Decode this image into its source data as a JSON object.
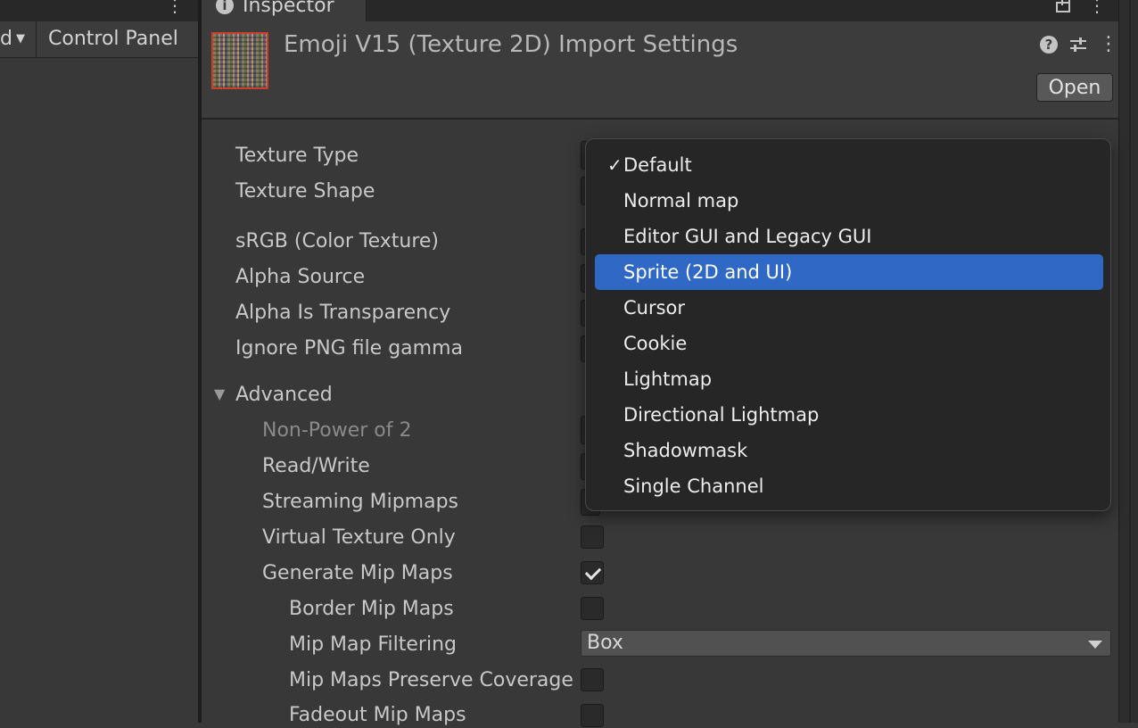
{
  "left_panel": {
    "dropdown_text": "d",
    "tab_label": "Control Panel"
  },
  "inspector": {
    "tab_title": "Inspector"
  },
  "header": {
    "title": "Emoji V15 (Texture 2D) Import Settings",
    "open_label": "Open"
  },
  "fields": {
    "texture_type": "Texture Type",
    "texture_shape": "Texture Shape",
    "srgb": "sRGB (Color Texture)",
    "alpha_source": "Alpha Source",
    "alpha_is_transparency": "Alpha Is Transparency",
    "ignore_png_gamma": "Ignore PNG file gamma",
    "advanced": "Advanced",
    "non_power_of_2": "Non-Power of 2",
    "read_write": "Read/Write",
    "streaming_mipmaps": "Streaming Mipmaps",
    "virtual_texture_only": "Virtual Texture Only",
    "generate_mip_maps": "Generate Mip Maps",
    "border_mip_maps": "Border Mip Maps",
    "mip_map_filtering": "Mip Map Filtering",
    "mip_map_filtering_value": "Box",
    "mip_maps_preserve_coverage": "Mip Maps Preserve Coverage",
    "fadeout_mip_maps": "Fadeout Mip Maps"
  },
  "checkbox_state": {
    "virtual_texture_only": false,
    "generate_mip_maps": true,
    "border_mip_maps": false,
    "mip_maps_preserve_coverage": false,
    "fadeout_mip_maps": false
  },
  "texture_type_menu": {
    "checked": "Default",
    "highlighted": "Sprite (2D and UI)",
    "items": [
      "Default",
      "Normal map",
      "Editor GUI and Legacy GUI",
      "Sprite (2D and UI)",
      "Cursor",
      "Cookie",
      "Lightmap",
      "Directional Lightmap",
      "Shadowmask",
      "Single Channel"
    ]
  },
  "icons": {
    "info": "info-icon",
    "help": "help-icon",
    "presets": "presets-icon",
    "lock": "lock-icon",
    "menu": "kebab-menu-icon",
    "foldout": "foldout-triangle-icon",
    "checkmark": "checkmark-icon",
    "dropdown": "chevron-down-icon"
  },
  "colors": {
    "panel_bg": "#383838",
    "menu_bg": "#262626",
    "menu_highlight": "#3069c5"
  }
}
